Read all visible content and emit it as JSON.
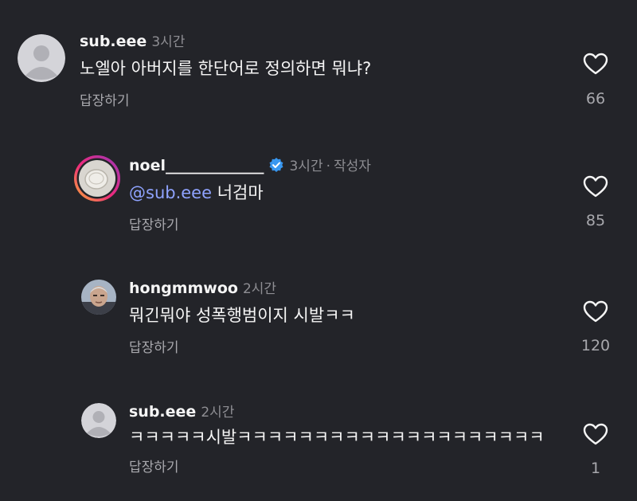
{
  "comments": [
    {
      "username": "sub.eee",
      "time": "3시간",
      "text": "노엘아 아버지를 한단어로 정의하면 뭐냐?",
      "reply_label": "답장하기",
      "likes": "66"
    },
    {
      "username": "noel_____________",
      "time": "3시간",
      "separator": "·",
      "author_badge": "작성자",
      "mention": "@sub.eee",
      "text": "너검마",
      "reply_label": "답장하기",
      "likes": "85"
    },
    {
      "username": "hongmmwoo",
      "time": "2시간",
      "text": "뭐긴뭐야 성폭행범이지 시발ㅋㅋ",
      "reply_label": "답장하기",
      "likes": "120"
    },
    {
      "username": "sub.eee",
      "time": "2시간",
      "text": "ㅋㅋㅋㅋㅋ시발ㅋㅋㅋㅋㅋㅋㅋㅋㅋㅋㅋㅋㅋㅋㅋㅋㅋㅋㅋㅋ",
      "reply_label": "답장하기",
      "likes": "1"
    }
  ],
  "icons": {
    "like": "heart-outline-icon",
    "verified": "verified-badge-icon",
    "default_avatar": "default-avatar-icon"
  },
  "colors": {
    "background": "#232429",
    "mention": "#8fa3ff",
    "verified": "#3897f0",
    "muted": "#8e8e93"
  }
}
